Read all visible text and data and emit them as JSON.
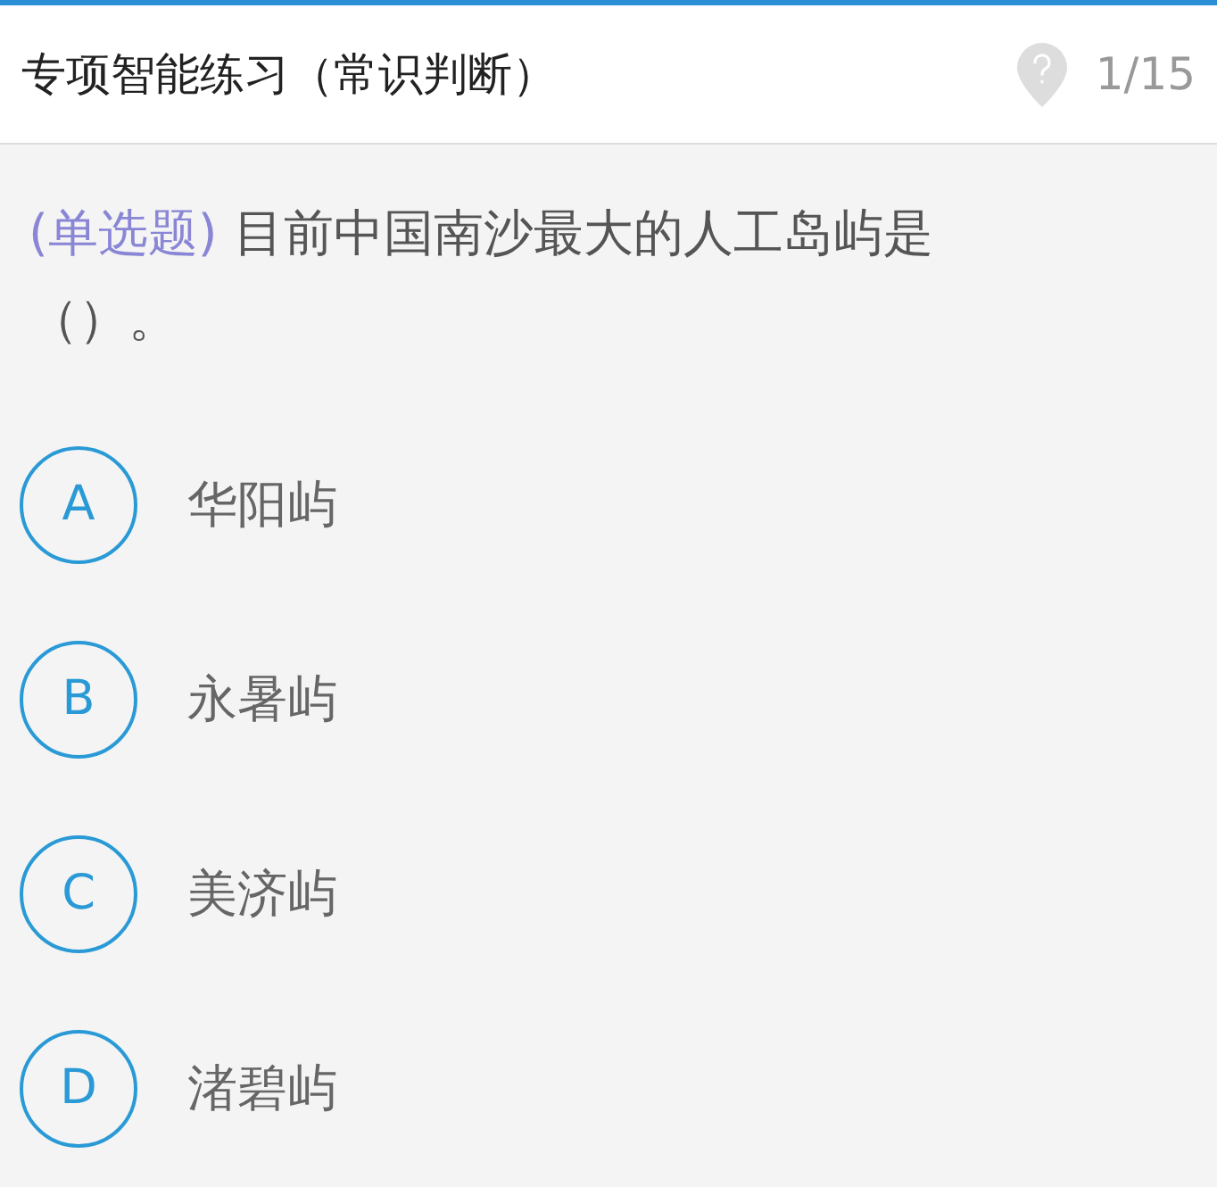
{
  "header": {
    "title": "专项智能练习（常识判断）",
    "progress": "1/15"
  },
  "question": {
    "type_label": "(单选题)",
    "text": "目前中国南沙最大的人工岛屿是（）。"
  },
  "options": [
    {
      "letter": "A",
      "text": "华阳屿"
    },
    {
      "letter": "B",
      "text": "永暑屿"
    },
    {
      "letter": "C",
      "text": "美济屿"
    },
    {
      "letter": "D",
      "text": "渚碧屿"
    }
  ]
}
